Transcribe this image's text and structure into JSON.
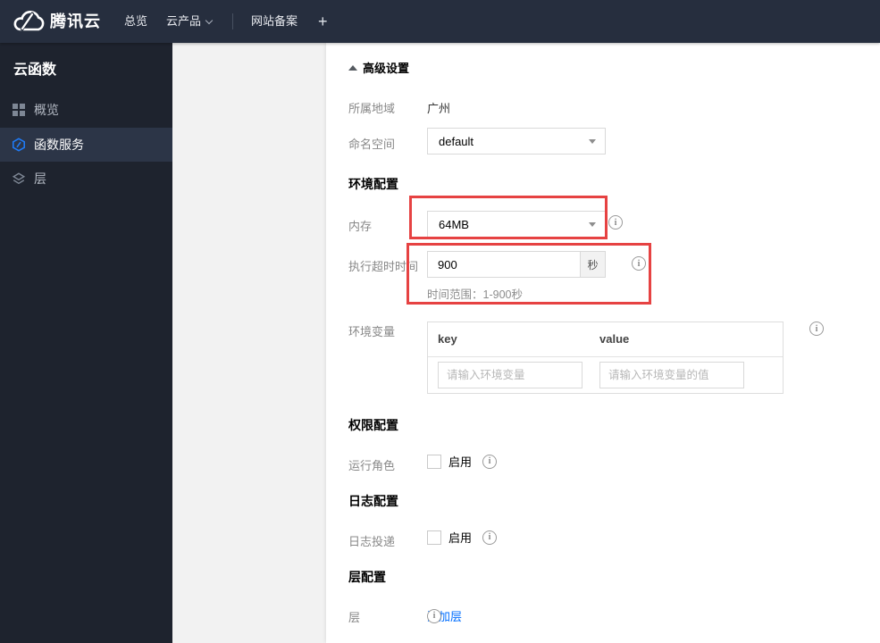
{
  "topbar": {
    "brand": "腾讯云",
    "nav": [
      {
        "label": "总览"
      },
      {
        "label": "云产品",
        "has_caret": true
      },
      {
        "label": "网站备案"
      }
    ],
    "plus_label": "+"
  },
  "sidebar": {
    "title": "云函数",
    "items": [
      {
        "label": "概览",
        "icon": "grid-icon",
        "active": false
      },
      {
        "label": "函数服务",
        "icon": "function-icon",
        "active": true
      },
      {
        "label": "层",
        "icon": "layers-icon",
        "active": false
      }
    ]
  },
  "content": {
    "advanced_toggle": {
      "label": "高级设置",
      "icon": "triangle-up"
    },
    "region": {
      "label": "所属地域",
      "value": "广州"
    },
    "namespace": {
      "label": "命名空间",
      "value": "default"
    },
    "sections": {
      "env": "环境配置",
      "perm": "权限配置",
      "log": "日志配置",
      "layer": "层配置"
    },
    "memory": {
      "label": "内存",
      "value": "64MB"
    },
    "timeout": {
      "label": "执行超时时间",
      "value": "900",
      "unit": "秒",
      "hint": "时间范围：1-900秒"
    },
    "env_vars": {
      "label": "环境变量",
      "columns": [
        "key",
        "value"
      ],
      "key_placeholder": "请输入环境变量",
      "value_placeholder": "请输入环境变量的值"
    },
    "role": {
      "label": "运行角色",
      "checkbox_label": "启用",
      "checked": false
    },
    "log_delivery": {
      "label": "日志投递",
      "checkbox_label": "启用",
      "checked": false
    },
    "layer": {
      "label": "层",
      "add_link": "添加层"
    }
  },
  "icons": {
    "info_glyph": "i"
  },
  "colors": {
    "topbar_bg": "#262e3e",
    "sidebar_bg": "#1e232e",
    "sidebar_active_bg": "#2c3547",
    "accent_blue": "#006eff",
    "highlight_red": "#e64242",
    "panel_gray": "#f2f2f2"
  }
}
